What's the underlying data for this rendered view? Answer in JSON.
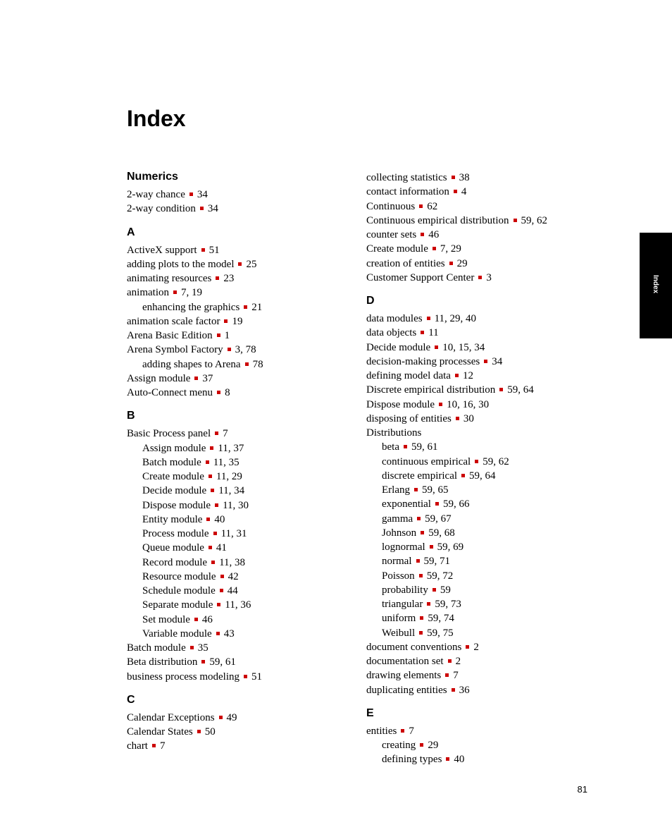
{
  "title": "Index",
  "side_tab": "Index",
  "page_number": "81",
  "columns": [
    {
      "sections": [
        {
          "heading": "Numerics",
          "first": true,
          "entries": [
            {
              "term": "2-way chance",
              "pages": "34",
              "indent": 0
            },
            {
              "term": "2-way condition",
              "pages": "34",
              "indent": 0
            }
          ]
        },
        {
          "heading": "A",
          "entries": [
            {
              "term": "ActiveX support",
              "pages": "51",
              "indent": 0
            },
            {
              "term": "adding plots to the model",
              "pages": "25",
              "indent": 0
            },
            {
              "term": "animating resources",
              "pages": "23",
              "indent": 0
            },
            {
              "term": "animation",
              "pages": "7, 19",
              "indent": 0
            },
            {
              "term": "enhancing the graphics",
              "pages": "21",
              "indent": 1
            },
            {
              "term": "animation scale factor",
              "pages": "19",
              "indent": 0
            },
            {
              "term": "Arena Basic Edition",
              "pages": "1",
              "indent": 0
            },
            {
              "term": "Arena Symbol Factory",
              "pages": "3, 78",
              "indent": 0
            },
            {
              "term": "adding shapes to Arena",
              "pages": "78",
              "indent": 1
            },
            {
              "term": "Assign module",
              "pages": "37",
              "indent": 0
            },
            {
              "term": "Auto-Connect menu",
              "pages": "8",
              "indent": 0
            }
          ]
        },
        {
          "heading": "B",
          "entries": [
            {
              "term": "Basic Process panel",
              "pages": "7",
              "indent": 0
            },
            {
              "term": "Assign module",
              "pages": "11, 37",
              "indent": 1
            },
            {
              "term": "Batch module",
              "pages": "11, 35",
              "indent": 1
            },
            {
              "term": "Create module",
              "pages": "11, 29",
              "indent": 1
            },
            {
              "term": "Decide module",
              "pages": "11, 34",
              "indent": 1
            },
            {
              "term": "Dispose module",
              "pages": "11, 30",
              "indent": 1
            },
            {
              "term": "Entity module",
              "pages": "40",
              "indent": 1
            },
            {
              "term": "Process module",
              "pages": "11, 31",
              "indent": 1
            },
            {
              "term": "Queue module",
              "pages": "41",
              "indent": 1
            },
            {
              "term": "Record module",
              "pages": "11, 38",
              "indent": 1
            },
            {
              "term": "Resource module",
              "pages": "42",
              "indent": 1
            },
            {
              "term": "Schedule module",
              "pages": "44",
              "indent": 1
            },
            {
              "term": "Separate module",
              "pages": "11, 36",
              "indent": 1
            },
            {
              "term": "Set module",
              "pages": "46",
              "indent": 1
            },
            {
              "term": "Variable module",
              "pages": "43",
              "indent": 1
            },
            {
              "term": "Batch module",
              "pages": "35",
              "indent": 0
            },
            {
              "term": "Beta distribution",
              "pages": "59, 61",
              "indent": 0
            },
            {
              "term": "business process modeling",
              "pages": "51",
              "indent": 0
            }
          ]
        },
        {
          "heading": "C",
          "entries": [
            {
              "term": "Calendar Exceptions",
              "pages": "49",
              "indent": 0
            },
            {
              "term": "Calendar States",
              "pages": "50",
              "indent": 0
            },
            {
              "term": "chart",
              "pages": "7",
              "indent": 0
            }
          ]
        }
      ]
    },
    {
      "sections": [
        {
          "heading": "",
          "first": true,
          "entries": [
            {
              "term": "collecting statistics",
              "pages": "38",
              "indent": 0
            },
            {
              "term": "contact information",
              "pages": "4",
              "indent": 0
            },
            {
              "term": "Continuous",
              "pages": "62",
              "indent": 0
            },
            {
              "term": "Continuous empirical distribution",
              "pages": "59, 62",
              "indent": 0
            },
            {
              "term": "counter sets",
              "pages": "46",
              "indent": 0
            },
            {
              "term": "Create module",
              "pages": "7, 29",
              "indent": 0
            },
            {
              "term": "creation of entities",
              "pages": "29",
              "indent": 0
            },
            {
              "term": "Customer Support Center",
              "pages": "3",
              "indent": 0
            }
          ]
        },
        {
          "heading": "D",
          "entries": [
            {
              "term": "data modules",
              "pages": "11, 29, 40",
              "indent": 0
            },
            {
              "term": "data objects",
              "pages": "11",
              "indent": 0
            },
            {
              "term": "Decide module",
              "pages": "10, 15, 34",
              "indent": 0
            },
            {
              "term": "decision-making processes",
              "pages": "34",
              "indent": 0
            },
            {
              "term": "defining model data",
              "pages": "12",
              "indent": 0
            },
            {
              "term": "Discrete empirical distribution",
              "pages": "59, 64",
              "indent": 0
            },
            {
              "term": "Dispose module",
              "pages": "10, 16, 30",
              "indent": 0
            },
            {
              "term": "disposing of entities",
              "pages": "30",
              "indent": 0
            },
            {
              "term": "Distributions",
              "pages": "",
              "indent": 0
            },
            {
              "term": "beta",
              "pages": "59, 61",
              "indent": 1
            },
            {
              "term": "continuous empirical",
              "pages": "59, 62",
              "indent": 1
            },
            {
              "term": "discrete empirical",
              "pages": "59, 64",
              "indent": 1
            },
            {
              "term": "Erlang",
              "pages": "59, 65",
              "indent": 1
            },
            {
              "term": "exponential",
              "pages": "59, 66",
              "indent": 1
            },
            {
              "term": "gamma",
              "pages": "59, 67",
              "indent": 1
            },
            {
              "term": "Johnson",
              "pages": "59, 68",
              "indent": 1
            },
            {
              "term": "lognormal",
              "pages": "59, 69",
              "indent": 1
            },
            {
              "term": "normal",
              "pages": "59, 71",
              "indent": 1
            },
            {
              "term": "Poisson",
              "pages": "59, 72",
              "indent": 1
            },
            {
              "term": "probability",
              "pages": "59",
              "indent": 1
            },
            {
              "term": "triangular",
              "pages": "59, 73",
              "indent": 1
            },
            {
              "term": "uniform",
              "pages": "59, 74",
              "indent": 1
            },
            {
              "term": "Weibull",
              "pages": "59, 75",
              "indent": 1
            },
            {
              "term": "document conventions",
              "pages": "2",
              "indent": 0
            },
            {
              "term": "documentation set",
              "pages": "2",
              "indent": 0
            },
            {
              "term": "drawing elements",
              "pages": "7",
              "indent": 0
            },
            {
              "term": "duplicating entities",
              "pages": "36",
              "indent": 0
            }
          ]
        },
        {
          "heading": "E",
          "entries": [
            {
              "term": "entities",
              "pages": "7",
              "indent": 0
            },
            {
              "term": "creating",
              "pages": "29",
              "indent": 1
            },
            {
              "term": "defining types",
              "pages": "40",
              "indent": 1
            }
          ]
        }
      ]
    }
  ]
}
